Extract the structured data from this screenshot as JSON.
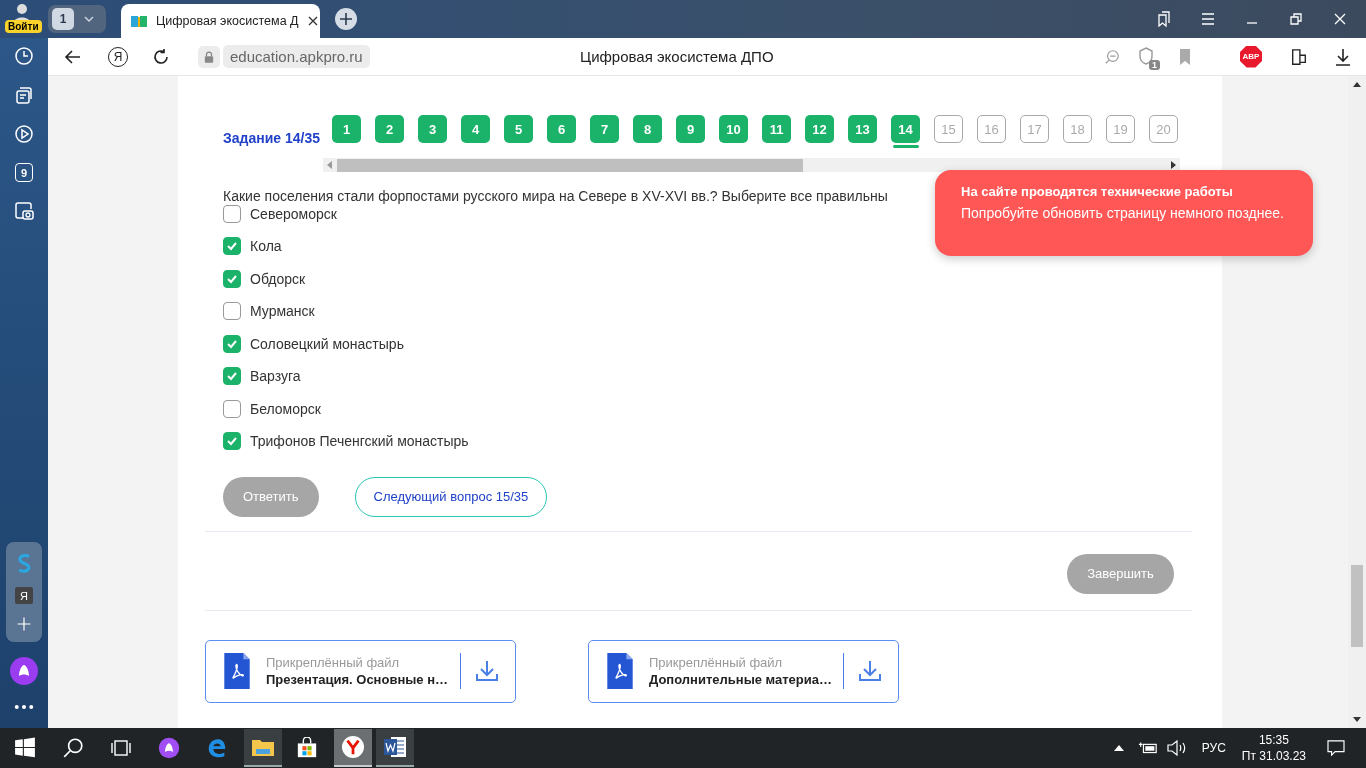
{
  "browser": {
    "login_badge": "Войти",
    "tab_count": "1",
    "tab": {
      "title": "Цифровая экосистема Д"
    },
    "yandex_button": "Я",
    "url": "education.apkpro.ru",
    "page_title": "Цифровая экосистема ДПО",
    "protect_badge": "1",
    "adblock_label": "ABP"
  },
  "sidebar": {
    "counter_icon": "9",
    "panel_letter": "Я"
  },
  "task": {
    "label": "Задание 14/35",
    "numbers": [
      {
        "label": "1",
        "answered": true,
        "selected": false
      },
      {
        "label": "2",
        "answered": true,
        "selected": false
      },
      {
        "label": "3",
        "answered": true,
        "selected": false
      },
      {
        "label": "4",
        "answered": true,
        "selected": false
      },
      {
        "label": "5",
        "answered": true,
        "selected": false
      },
      {
        "label": "6",
        "answered": true,
        "selected": false
      },
      {
        "label": "7",
        "answered": true,
        "selected": false
      },
      {
        "label": "8",
        "answered": true,
        "selected": false
      },
      {
        "label": "9",
        "answered": true,
        "selected": false
      },
      {
        "label": "10",
        "answered": true,
        "selected": false
      },
      {
        "label": "11",
        "answered": true,
        "selected": false
      },
      {
        "label": "12",
        "answered": true,
        "selected": false
      },
      {
        "label": "13",
        "answered": true,
        "selected": false
      },
      {
        "label": "14",
        "answered": true,
        "selected": true
      },
      {
        "label": "15",
        "answered": false,
        "selected": false
      },
      {
        "label": "16",
        "answered": false,
        "selected": false
      },
      {
        "label": "17",
        "answered": false,
        "selected": false
      },
      {
        "label": "18",
        "answered": false,
        "selected": false
      },
      {
        "label": "19",
        "answered": false,
        "selected": false
      },
      {
        "label": "20",
        "answered": false,
        "selected": false
      }
    ]
  },
  "question": {
    "text": "Какие поселения стали форпостами русского мира на Севере в XV-XVI вв.? Выберите все правильны",
    "options": [
      {
        "label": "Североморск",
        "checked": false
      },
      {
        "label": "Кола",
        "checked": true
      },
      {
        "label": "Обдорск",
        "checked": true
      },
      {
        "label": "Мурманск",
        "checked": false
      },
      {
        "label": "Соловецкий монастырь",
        "checked": true
      },
      {
        "label": "Варзуга",
        "checked": true
      },
      {
        "label": "Беломорск",
        "checked": false
      },
      {
        "label": "Трифонов Печенгский монастырь",
        "checked": true
      }
    ]
  },
  "buttons": {
    "answer": {
      "label": "Ответить",
      "disabled": true
    },
    "next": {
      "label": "Следующий вопрос 15/35"
    },
    "finish": {
      "label": "Завершить",
      "disabled": true
    }
  },
  "attachments": [
    {
      "caption": "Прикреплённый файл",
      "name": "Презентация. Основные н…"
    },
    {
      "caption": "Прикреплённый файл",
      "name": "Дополнительные материа…"
    }
  ],
  "toast": {
    "title": "На сайте проводятся технические работы",
    "message": "Попробуйте обновить страницу немного позднее."
  },
  "taskbar": {
    "language": "РУС",
    "time": "15:35",
    "date": "Пт 31.03.23"
  }
}
